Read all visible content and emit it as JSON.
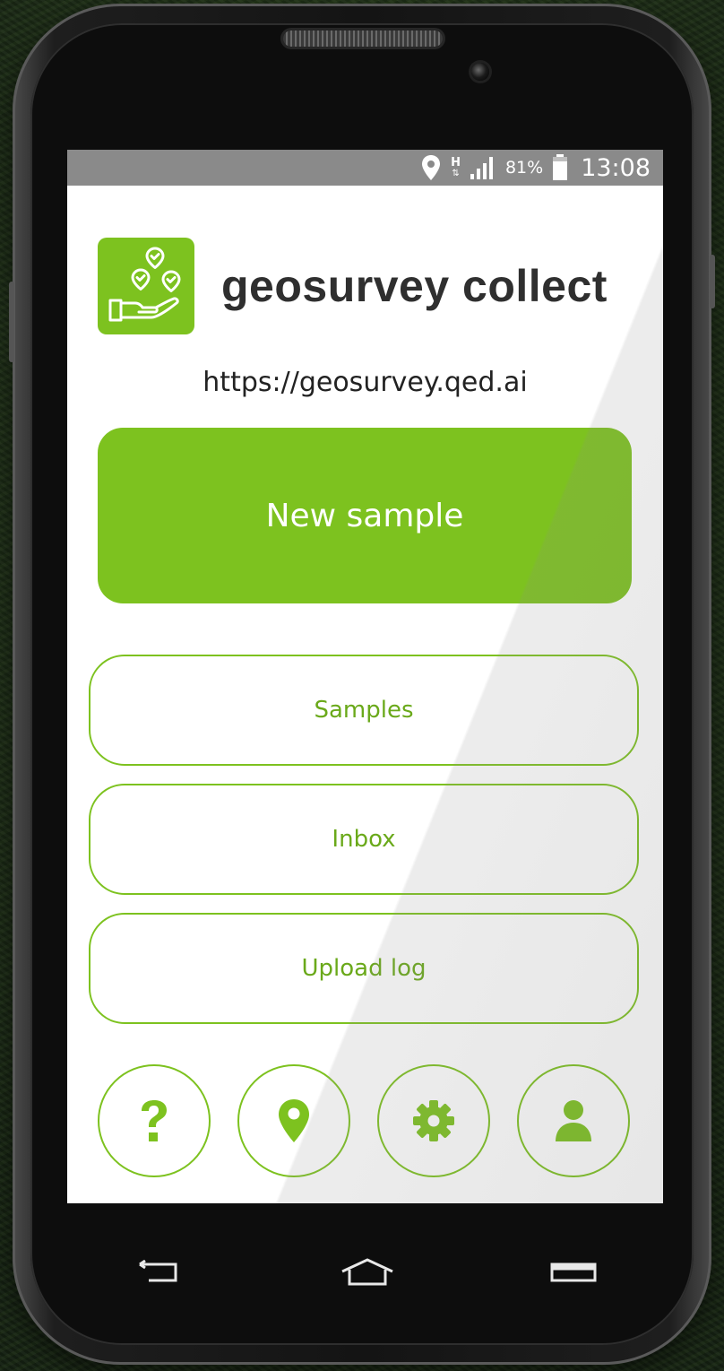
{
  "status_bar": {
    "location_icon": "location-pin-icon",
    "network_type": "H",
    "signal_icon": "signal-bars-icon",
    "battery_percent": "81%",
    "battery_icon": "battery-icon",
    "time": "13:08"
  },
  "app": {
    "title": "geosurvey collect",
    "logo_icon": "hand-with-pins-icon",
    "server_url": "https://geosurvey.qed.ai"
  },
  "actions": {
    "new_sample": "New sample",
    "samples": "Samples",
    "inbox": "Inbox",
    "upload_log": "Upload log"
  },
  "bottom_icons": [
    "help-icon",
    "location-pin-icon",
    "gear-icon",
    "user-icon"
  ],
  "navigation": [
    "back-icon",
    "home-icon",
    "recent-apps-icon"
  ],
  "colors": {
    "accent": "#7dc21f",
    "accent_text": "#6aa91a",
    "status_bar": "#8a8a8a"
  }
}
